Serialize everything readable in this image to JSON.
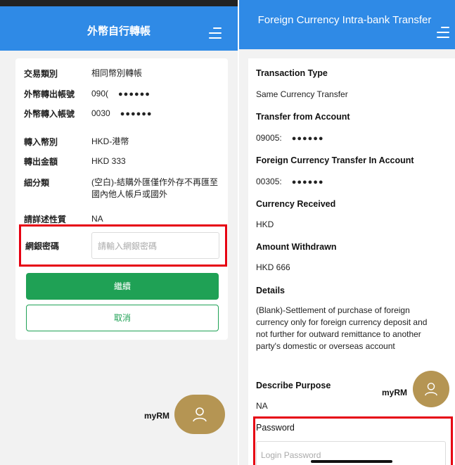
{
  "left": {
    "header_title": "外幣自行轉帳",
    "rows": [
      {
        "label": "交易類別",
        "value": "相同幣別轉帳"
      },
      {
        "label": "外幣轉出帳號",
        "value": "090(",
        "mask": "●●●●●●"
      },
      {
        "label": "外幣轉入帳號",
        "value": "0030",
        "mask": "●●●●●●"
      },
      {
        "label": "轉入幣別",
        "value": "HKD-港幣"
      },
      {
        "label": "轉出金額",
        "value": "HKD 333"
      },
      {
        "label": "細分類",
        "value": "(空白)-結購外匯僅作外存不再匯至國內他人帳戶或國外"
      },
      {
        "label": "請詳述性質",
        "value": "NA"
      }
    ],
    "password_label": "網銀密碼",
    "password_placeholder": "請輸入網銀密碼",
    "continue_label": "繼續",
    "cancel_label": "取消",
    "myrm_label": "myRM"
  },
  "right": {
    "header_title": "Foreign Currency Intra-bank Transfer",
    "fields": [
      {
        "label": "Transaction Type",
        "value": "Same Currency Transfer"
      },
      {
        "label": "Transfer from Account",
        "value": "09005:",
        "mask": "●●●●●●"
      },
      {
        "label": "Foreign Currency Transfer In Account",
        "value": "00305:",
        "mask": "●●●●●●"
      },
      {
        "label": "Currency Received",
        "value": "HKD"
      },
      {
        "label": "Amount Withdrawn",
        "value": "HKD 666"
      },
      {
        "label": "Details",
        "value": "(Blank)-Settlement of purchase of foreign currency only for foreign currency deposit and not further for outward remittance to another party's domestic or overseas account"
      },
      {
        "label": "Describe Purpose",
        "value": "NA"
      }
    ],
    "password_label": "Password",
    "password_placeholder": "Login Password",
    "myrm_label": "myRM"
  },
  "colors": {
    "header_blue": "#2f8ae6",
    "button_green": "#1fa155",
    "highlight_red": "#e60012",
    "myrm_gold": "#b59553"
  },
  "icons": {
    "menu": "hamburger-menu-icon",
    "avatar": "person-icon"
  }
}
